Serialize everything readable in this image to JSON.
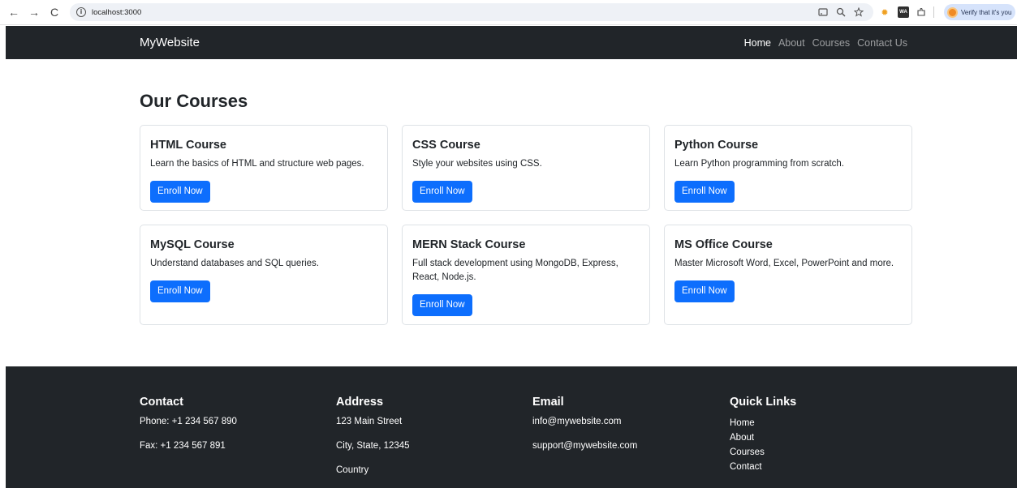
{
  "browser": {
    "back_glyph": "←",
    "forward_glyph": "→",
    "reload_glyph": "C",
    "info_glyph": "i",
    "url": "localhost:3000",
    "verify_text": "Verify that it's you",
    "ext_wa_label": "WA"
  },
  "navbar": {
    "brand": "MyWebsite",
    "links": [
      "Home",
      "About",
      "Courses",
      "Contact Us"
    ]
  },
  "main": {
    "title": "Our Courses",
    "courses": [
      {
        "title": "HTML Course",
        "text": "Learn the basics of HTML and structure web pages.",
        "button": "Enroll Now"
      },
      {
        "title": "CSS Course",
        "text": "Style your websites using CSS.",
        "button": "Enroll Now"
      },
      {
        "title": "Python Course",
        "text": "Learn Python programming from scratch.",
        "button": "Enroll Now"
      },
      {
        "title": "MySQL Course",
        "text": "Understand databases and SQL queries.",
        "button": "Enroll Now"
      },
      {
        "title": "MERN Stack Course",
        "text": "Full stack development using MongoDB, Express, React, Node.js.",
        "button": "Enroll Now"
      },
      {
        "title": "MS Office Course",
        "text": "Master Microsoft Word, Excel, PowerPoint and more.",
        "button": "Enroll Now"
      }
    ]
  },
  "footer": {
    "contact": {
      "heading": "Contact",
      "lines": [
        "Phone: +1 234 567 890",
        "Fax: +1 234 567 891"
      ]
    },
    "address": {
      "heading": "Address",
      "lines": [
        "123 Main Street",
        "City, State, 12345",
        "Country"
      ]
    },
    "email": {
      "heading": "Email",
      "lines": [
        "info@mywebsite.com",
        "support@mywebsite.com"
      ]
    },
    "quick_links": {
      "heading": "Quick Links",
      "links": [
        "Home",
        "About",
        "Courses",
        "Contact"
      ]
    }
  },
  "colors": {
    "navbar_bg": "#212529",
    "primary_button": "#0d6efd",
    "footer_bg": "#212529"
  }
}
